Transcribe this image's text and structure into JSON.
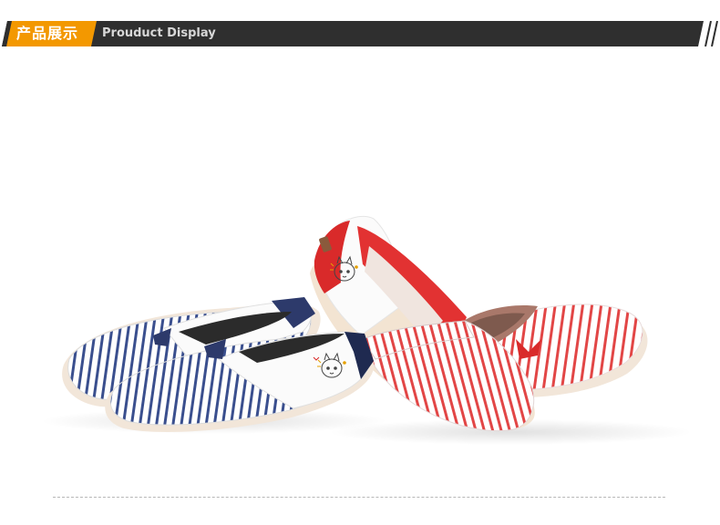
{
  "header": {
    "title_cn": "产品展示",
    "title_en": "Prouduct Display"
  },
  "product_photo": {
    "subject": "striped canvas slip-on shoes",
    "variants": [
      "navy striped pair",
      "red striped pair"
    ]
  },
  "colors": {
    "bar_dark": "#2f2f2f",
    "accent_orange": "#f39800",
    "stripe_navy": "#3a4f8e",
    "stripe_red": "#e24646",
    "heel_red": "#d92a2a"
  }
}
